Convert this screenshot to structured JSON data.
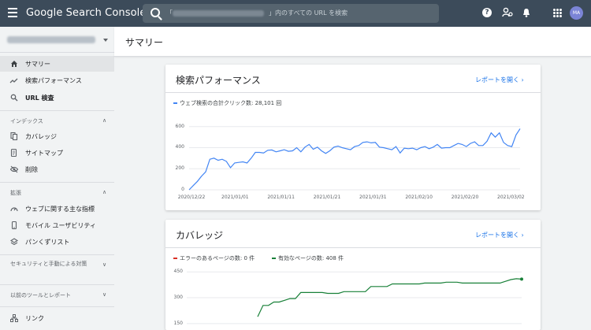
{
  "app": {
    "title": "Google Search Console"
  },
  "search": {
    "prefix": "「",
    "text": "」内のすべての URL を検索"
  },
  "avatar": {
    "initials": "MA"
  },
  "page": {
    "title": "サマリー"
  },
  "sidebar": {
    "items": [
      {
        "label": "サマリー",
        "icon": "home-icon"
      },
      {
        "label": "検索パフォーマンス",
        "icon": "trend-icon"
      },
      {
        "label": "URL 検査",
        "icon": "search-icon"
      }
    ],
    "sections": [
      {
        "label": "インデックス",
        "items": [
          {
            "label": "カバレッジ",
            "icon": "file-copy-icon"
          },
          {
            "label": "サイトマップ",
            "icon": "sitemap-icon"
          },
          {
            "label": "削除",
            "icon": "eye-off-icon"
          }
        ]
      },
      {
        "label": "拡張",
        "items": [
          {
            "label": "ウェブに関する主な指標",
            "icon": "speed-icon"
          },
          {
            "label": "モバイル ユーザビリティ",
            "icon": "phone-icon"
          },
          {
            "label": "パンくずリスト",
            "icon": "layers-icon"
          }
        ]
      },
      {
        "label": "セキュリティと手動による対策"
      },
      {
        "label": "以前のツールとレポート"
      }
    ],
    "bottom_item": {
      "label": "リンク",
      "icon": "links-icon"
    }
  },
  "cards": {
    "performance": {
      "title": "検索パフォーマンス",
      "link": "レポートを開く",
      "legend": "ウェブ検索の合計クリック数: 28,101 回"
    },
    "coverage": {
      "title": "カバレッジ",
      "link": "レポートを開く",
      "legend_error": "エラーのあるページの数: 0 件",
      "legend_valid": "有効なページの数: 408 件"
    }
  },
  "colors": {
    "blue": "#4285f4",
    "green": "#188038",
    "red": "#d93025",
    "link": "#1a73e8",
    "topbar": "#3c4b5a"
  },
  "chart_data": [
    {
      "type": "line",
      "series": [
        {
          "name": "ウェブ検索の合計クリック数: 28,101 回",
          "color": "#4285f4",
          "values": [
            0,
            40,
            80,
            130,
            170,
            290,
            300,
            280,
            290,
            270,
            210,
            255,
            260,
            265,
            255,
            300,
            355,
            355,
            350,
            375,
            378,
            360,
            370,
            380,
            365,
            370,
            400,
            360,
            405,
            430,
            385,
            405,
            370,
            345,
            370,
            405,
            415,
            400,
            390,
            380,
            410,
            420,
            450,
            455,
            445,
            450,
            405,
            400,
            390,
            380,
            410,
            350,
            395,
            390,
            395,
            380,
            400,
            410,
            390,
            405,
            430,
            395,
            400,
            400,
            420,
            440,
            430,
            410,
            440,
            455,
            420,
            420,
            460,
            540,
            500,
            540,
            450,
            420,
            410,
            520,
            580
          ]
        }
      ],
      "x_ticks": [
        "2020/12/22",
        "2021/01/01",
        "2021/01/11",
        "2021/01/21",
        "2021/01/31",
        "2021/02/10",
        "2021/02/20",
        "2021/03/02"
      ],
      "y_ticks": [
        "0",
        "200",
        "400",
        "600"
      ],
      "ylim": [
        0,
        650
      ]
    },
    {
      "type": "line",
      "series": [
        {
          "name": "エラーのあるページの数: 0 件",
          "color": "#d93025",
          "values": []
        },
        {
          "name": "有効なページの数: 408 件",
          "color": "#188038",
          "values": [
            190,
            255,
            255,
            275,
            275,
            285,
            295,
            295,
            330,
            330,
            330,
            330,
            330,
            325,
            325,
            325,
            335,
            335,
            335,
            335,
            335,
            365,
            365,
            365,
            365,
            380,
            380,
            380,
            380,
            380,
            380,
            385,
            385,
            385,
            385,
            390,
            390,
            390,
            385,
            385,
            385,
            385,
            385,
            385,
            385,
            385,
            395,
            405,
            410,
            408
          ]
        }
      ],
      "y_ticks": [
        "150",
        "300",
        "450"
      ],
      "ylim": [
        140,
        460
      ]
    }
  ]
}
